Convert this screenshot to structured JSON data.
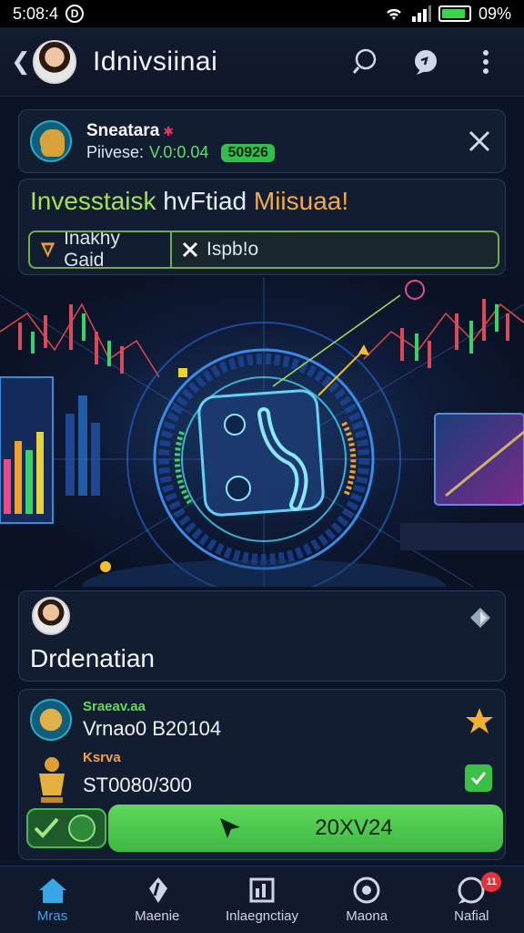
{
  "status_bar": {
    "time": "5:08:4",
    "battery": "09%",
    "battery_level": 0.9
  },
  "app_bar": {
    "back_icon": "chevron-left-icon",
    "title": "Idnivsiinai"
  },
  "profile": {
    "name": "Sneatara",
    "version_label": "Piivese:",
    "version_value": "V.0:0.04",
    "badge": "50926"
  },
  "invest": {
    "title_part1": "Invesstaisk",
    "title_part2": "hvFtiad",
    "title_part3": "Miisuaa!",
    "segment_1": "Inakhy Gaid",
    "segment_2": "Ispb!o"
  },
  "dre_card": {
    "title": "Drdenatian"
  },
  "trade": {
    "row1_label": "Sraeav.aa",
    "row1_value": "Vrnao0 B20104",
    "row2_label": "Ksrva",
    "row2_value": "ST0080/300",
    "button_label": "20XV24"
  },
  "nav": [
    {
      "label": "Mras",
      "icon": "home-icon",
      "active": true
    },
    {
      "label": "Maenie",
      "icon": "leaf-icon",
      "active": false
    },
    {
      "label": "Inlaegnctiay",
      "icon": "chart-icon",
      "active": false
    },
    {
      "label": "Maona",
      "icon": "target-icon",
      "active": false
    },
    {
      "label": "Nafial",
      "icon": "chat-icon",
      "active": false,
      "badge": "11"
    }
  ],
  "colors": {
    "accent_green": "#3fb845",
    "accent_blue": "#38a7e8",
    "background": "#0b1426"
  }
}
